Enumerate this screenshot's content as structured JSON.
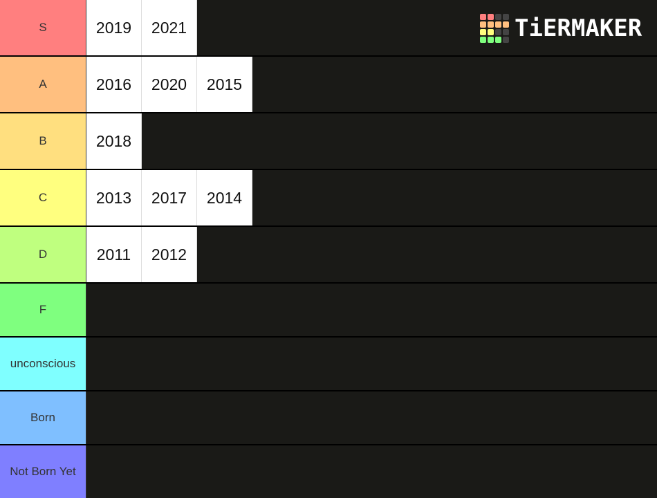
{
  "logo": {
    "text": "TiERMAKER",
    "grid_colors": [
      "#ff7f7f",
      "#ff7f7f",
      "#444444",
      "#444444",
      "#ffbf7f",
      "#ffbf7f",
      "#ffbf7f",
      "#ffbf7f",
      "#ffff7f",
      "#ffff7f",
      "#444444",
      "#444444",
      "#7fff7f",
      "#7fff7f",
      "#7fff7f",
      "#444444"
    ]
  },
  "tiers": [
    {
      "label": "S",
      "color": "#ff7f7f",
      "items": [
        "2019",
        "2021"
      ]
    },
    {
      "label": "A",
      "color": "#ffbf7f",
      "items": [
        "2016",
        "2020",
        "2015"
      ]
    },
    {
      "label": "B",
      "color": "#ffdf7f",
      "items": [
        "2018"
      ]
    },
    {
      "label": "C",
      "color": "#ffff7f",
      "items": [
        "2013",
        "2017",
        "2014"
      ]
    },
    {
      "label": "D",
      "color": "#bfff7f",
      "items": [
        "2011",
        "2012"
      ]
    },
    {
      "label": "F",
      "color": "#7fff7f",
      "items": []
    },
    {
      "label": "unconscious",
      "color": "#7fffff",
      "items": []
    },
    {
      "label": "Born",
      "color": "#7fbfff",
      "items": []
    },
    {
      "label": "Not Born Yet",
      "color": "#7f7fff",
      "items": []
    }
  ]
}
